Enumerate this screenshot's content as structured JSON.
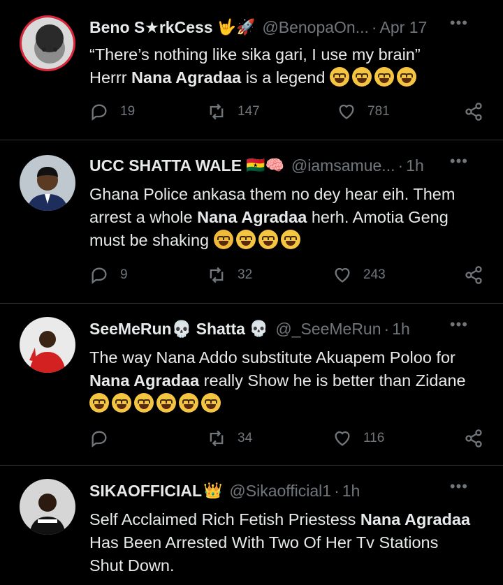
{
  "tweets": [
    {
      "name": "Beno S★rkCess",
      "name_emoji": "🤟🚀",
      "handle": "@BenopaOn...",
      "time": "Apr 17",
      "line1": "“There’s nothing like sika gari, I use my brain”",
      "line2_pre": "Herrr ",
      "line2_bold": "Nana Agradaa",
      "line2_post": " is a legend",
      "emojis": [
        "😂",
        "😂",
        "🤣",
        "🤣"
      ],
      "replies": "19",
      "retweets": "147",
      "likes": "781"
    },
    {
      "name": "UCC SHATTA WALE",
      "name_emoji": "🇬🇭🧠",
      "handle": "@iamsamue...",
      "time": "1h",
      "line1": "Ghana Police ankasa them no dey hear eih. Them",
      "line2_pre": "arrest a whole ",
      "line2_bold": "Nana Agradaa",
      "line2_post": " herh. Amotia Geng",
      "line3": "must be shaking",
      "emojis": [
        "😭",
        "😂",
        "😂",
        "😂"
      ],
      "replies": "9",
      "retweets": "32",
      "likes": "243"
    },
    {
      "name": "SeeMeRun💀 Shatta",
      "name_emoji": "💀",
      "handle": "@_SeeMeRun",
      "time": "1h",
      "line1": "The way Nana Addo substitute Akuapem Poloo for",
      "line2_bold": "Nana Agradaa",
      "line2_post": " really Show he is better than Zidane",
      "emojis": [
        "😩",
        "😄",
        "😄",
        "😄",
        "😄",
        "😄"
      ],
      "replies": "",
      "retweets": "34",
      "likes": "116"
    },
    {
      "name": "SIKAOFFICIAL",
      "name_emoji": "👑",
      "handle": "@Sikaofficial1",
      "time": "1h",
      "line1_pre": "Self Acclaimed Rich Fetish Priestess ",
      "line1_bold": "Nana Agradaa",
      "line2": "Has Been Arrested With Two Of Her Tv Stations",
      "line3": "Shut Down."
    }
  ],
  "more_glyph": "•••",
  "separator": "·"
}
